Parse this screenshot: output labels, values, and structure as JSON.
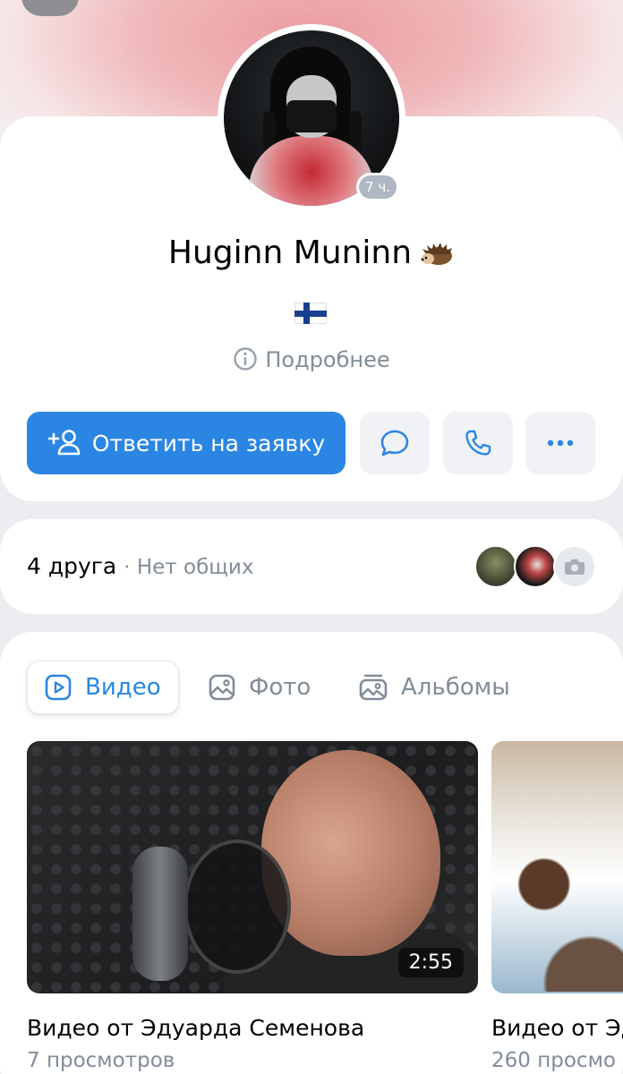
{
  "profile": {
    "name": "Huginn Muninn",
    "online_ago": "7 ч.",
    "details_label": "Подробнее"
  },
  "actions": {
    "primary_label": "Ответить на заявку",
    "message_icon": "message-icon",
    "call_icon": "phone-icon",
    "more_icon": "more-icon"
  },
  "friends": {
    "count_label": "4 друга",
    "mutual_label": "· Нет общих"
  },
  "tabs": [
    {
      "label": "Видео",
      "icon": "video-icon",
      "active": true
    },
    {
      "label": "Фото",
      "icon": "photo-icon",
      "active": false
    },
    {
      "label": "Альбомы",
      "icon": "albums-icon",
      "active": false
    }
  ],
  "videos": [
    {
      "title": "Видео от Эдуарда Семенова",
      "views": "7 просмотров",
      "duration": "2:55"
    },
    {
      "title": "Видео от Эд",
      "views": "260 просмо"
    }
  ],
  "colors": {
    "accent": "#2b86e3",
    "secondary_text": "#818c99",
    "background": "#ebedf0",
    "badge": "#aeb7c2"
  }
}
